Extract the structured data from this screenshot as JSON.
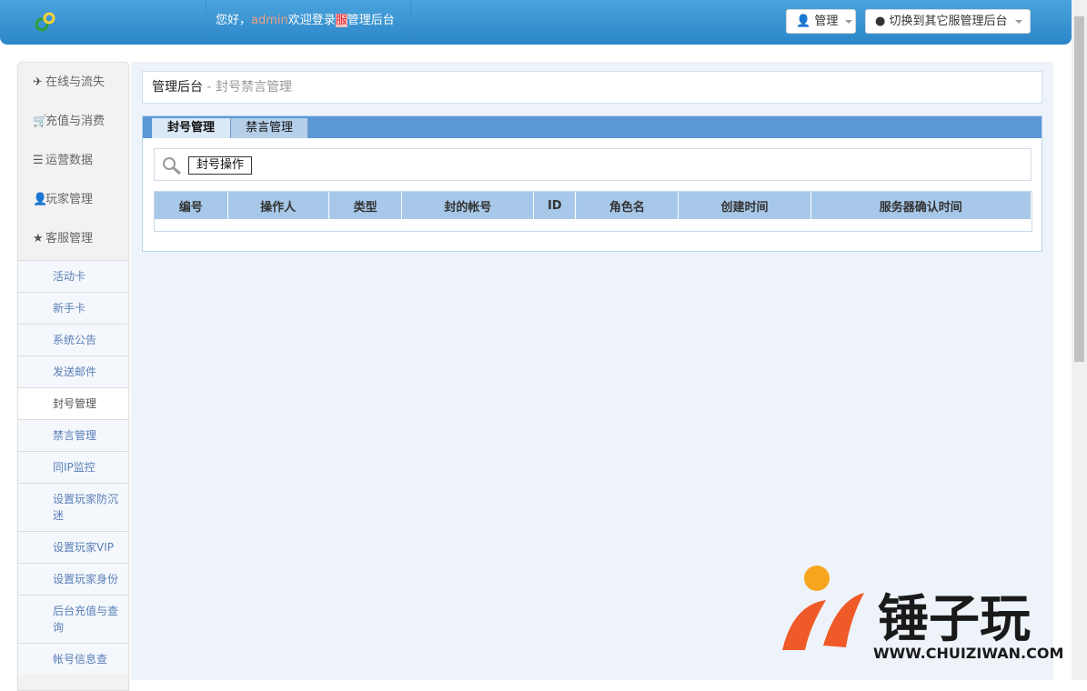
{
  "header": {
    "greeting": "您好，",
    "user": "admin",
    "welcome": "欢迎登录",
    "server_mark": "服",
    "backend": "管理后台",
    "manage_label": "管理",
    "switch_label": "切换到其它服管理后台"
  },
  "sidebar": {
    "groups": [
      {
        "icon": "plane-icon",
        "label": "在线与流失"
      },
      {
        "icon": "cart-icon",
        "label": "充值与消费"
      },
      {
        "icon": "list-icon",
        "label": "运营数据"
      },
      {
        "icon": "user-icon",
        "label": "玩家管理"
      },
      {
        "icon": "star-icon",
        "label": "客服管理"
      }
    ],
    "items": [
      {
        "label": "活动卡"
      },
      {
        "label": "新手卡"
      },
      {
        "label": "系统公告"
      },
      {
        "label": "发送邮件"
      },
      {
        "label": "封号管理"
      },
      {
        "label": "禁言管理"
      },
      {
        "label": "同IP监控"
      },
      {
        "label": "设置玩家防沉迷"
      },
      {
        "label": "设置玩家VIP"
      },
      {
        "label": "设置玩家身份"
      },
      {
        "label": "后台充值与查询"
      },
      {
        "label": "帐号信息查"
      }
    ],
    "active_item": "封号管理"
  },
  "breadcrumb": {
    "root": "管理后台",
    "sep": " - ",
    "current": "封号禁言管理"
  },
  "tabs": [
    {
      "label": "封号管理"
    },
    {
      "label": "禁言管理"
    }
  ],
  "search": {
    "action_label": "封号操作"
  },
  "table": {
    "columns": [
      "编号",
      "操作人",
      "类型",
      "封的帐号",
      "ID",
      "角色名",
      "创建时间",
      "服务器确认时间"
    ],
    "rows": []
  },
  "watermark": {
    "text": "锤子玩",
    "url": "WWW.CHUIZIWAN.COM"
  }
}
